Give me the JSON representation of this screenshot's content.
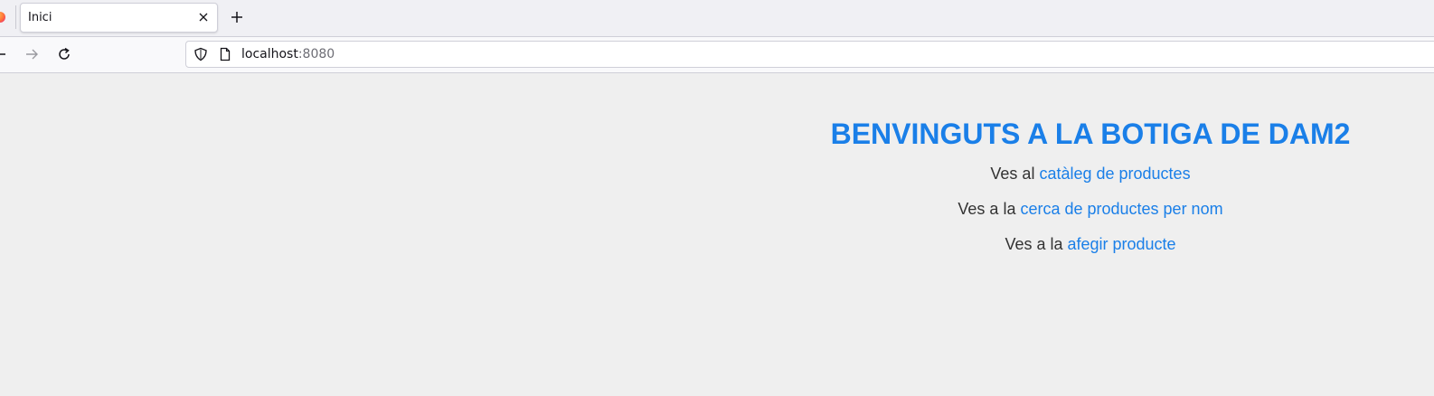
{
  "browser": {
    "tab_title": "Inici",
    "url_host": "localhost",
    "url_port": ":8080",
    "icons": [
      "firefox-logo",
      "close-icon",
      "plus-icon",
      "back-arrow-icon",
      "forward-arrow-icon",
      "reload-icon",
      "shield-icon",
      "page-icon"
    ]
  },
  "page": {
    "heading": "BENVINGUTS A LA BOTIGA DE DAM2",
    "links": [
      {
        "prefix": "Ves al ",
        "link_text": "catàleg de productes"
      },
      {
        "prefix": "Ves a la ",
        "link_text": "cerca de productes per nom"
      },
      {
        "prefix": "Ves a la ",
        "link_text": "afegir producte"
      }
    ],
    "colors": {
      "background": "#efefef",
      "heading": "#1a7fe8",
      "link": "#1a7fe8",
      "text": "#333333"
    }
  }
}
